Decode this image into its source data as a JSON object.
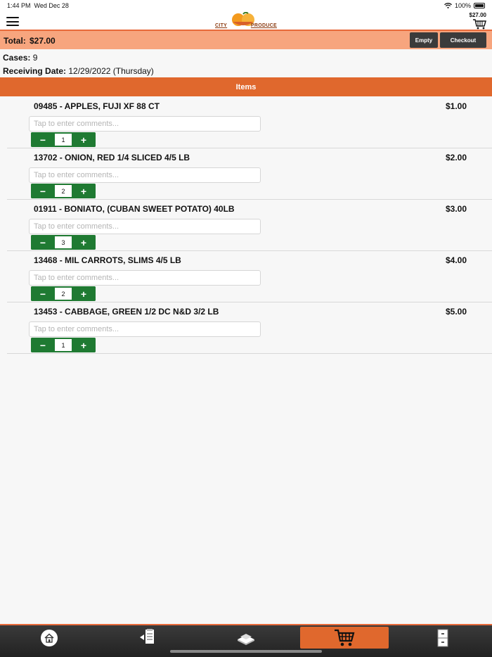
{
  "status": {
    "time": "1:44 PM",
    "date": "Wed Dec 28",
    "battery": "100%"
  },
  "header": {
    "logo_left": "CITY",
    "logo_right": "PRODUCE",
    "cart_total": "$27.00"
  },
  "total_bar": {
    "label": "Total:",
    "value": "$27.00",
    "empty_label": "Empty",
    "checkout_label": "Checkout"
  },
  "info": {
    "cases_label": "Cases:",
    "cases_value": "9",
    "date_label": "Receiving Date:",
    "date_value": "12/29/2022 (Thursday)"
  },
  "items_header": "Items",
  "comment_placeholder": "Tap to enter comments...",
  "items": [
    {
      "name": "09485 - APPLES, FUJI XF 88 CT",
      "price": "$1.00",
      "qty": "1"
    },
    {
      "name": "13702 - ONION, RED 1/4 SLICED 4/5 LB",
      "price": "$2.00",
      "qty": "2"
    },
    {
      "name": "01911 - BONIATO, (CUBAN SWEET POTATO) 40LB",
      "price": "$3.00",
      "qty": "3"
    },
    {
      "name": "13468 - MIL CARROTS, SLIMS 4/5 LB",
      "price": "$4.00",
      "qty": "2"
    },
    {
      "name": "13453 - CABBAGE, GREEN 1/2 DC N&D 3/2 LB",
      "price": "$5.00",
      "qty": "1"
    }
  ],
  "stepper": {
    "minus": "−",
    "plus": "+"
  },
  "colors": {
    "accent": "#e0682d",
    "total_bar": "#f7a57e",
    "stepper": "#1f7a32",
    "dark_button": "#3b3b3b"
  },
  "nav_icons": [
    "home-icon",
    "order-guide-icon",
    "catalog-icon",
    "cart-icon",
    "cabinet-icon"
  ]
}
